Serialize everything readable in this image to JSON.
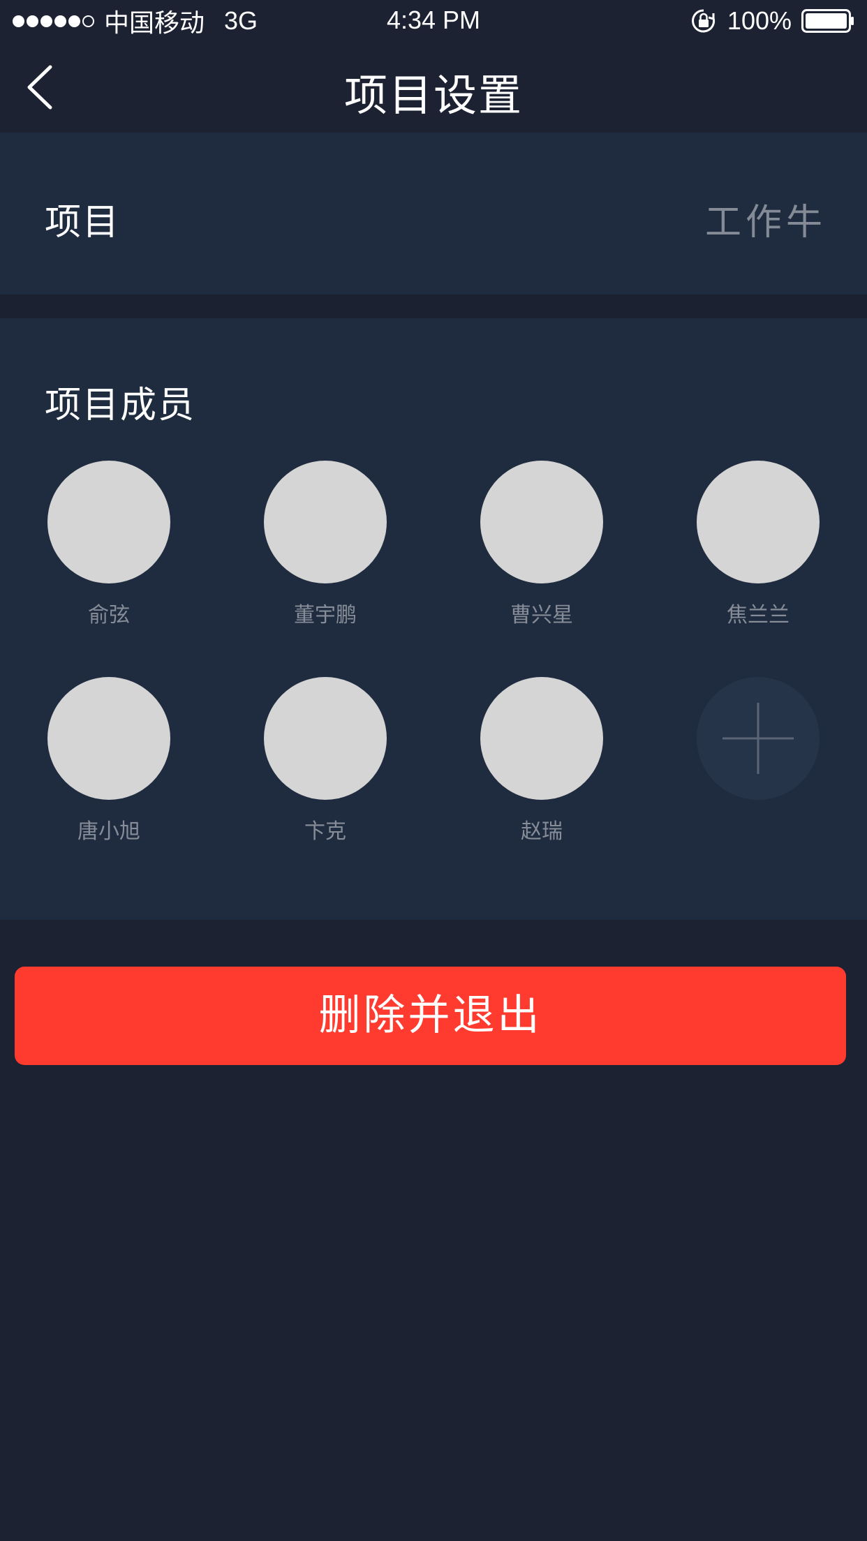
{
  "status_bar": {
    "carrier": "中国移动",
    "network": "3G",
    "time": "4:34 PM",
    "battery": "100%",
    "signal_bars_filled": 5,
    "signal_bars_total": 6,
    "icons": [
      "signal-icon",
      "orientation-lock-icon",
      "battery-icon"
    ]
  },
  "nav": {
    "title": "项目设置",
    "back_icon": "chevron-left-icon"
  },
  "project": {
    "label": "项目",
    "value": "工作牛"
  },
  "members": {
    "title": "项目成员",
    "list": [
      {
        "name": "俞弦"
      },
      {
        "name": "董宇鹏"
      },
      {
        "name": "曹兴星"
      },
      {
        "name": "焦兰兰"
      },
      {
        "name": "唐小旭"
      },
      {
        "name": "卞克"
      },
      {
        "name": "赵瑞"
      }
    ],
    "add_icon": "plus-icon"
  },
  "actions": {
    "delete_label": "删除并退出"
  },
  "colors": {
    "background": "#1c2232",
    "panel": "#1f2b3e",
    "accent_red": "#ff3b30",
    "avatar_placeholder": "#d5d5d6",
    "muted_text": "#868d98"
  }
}
